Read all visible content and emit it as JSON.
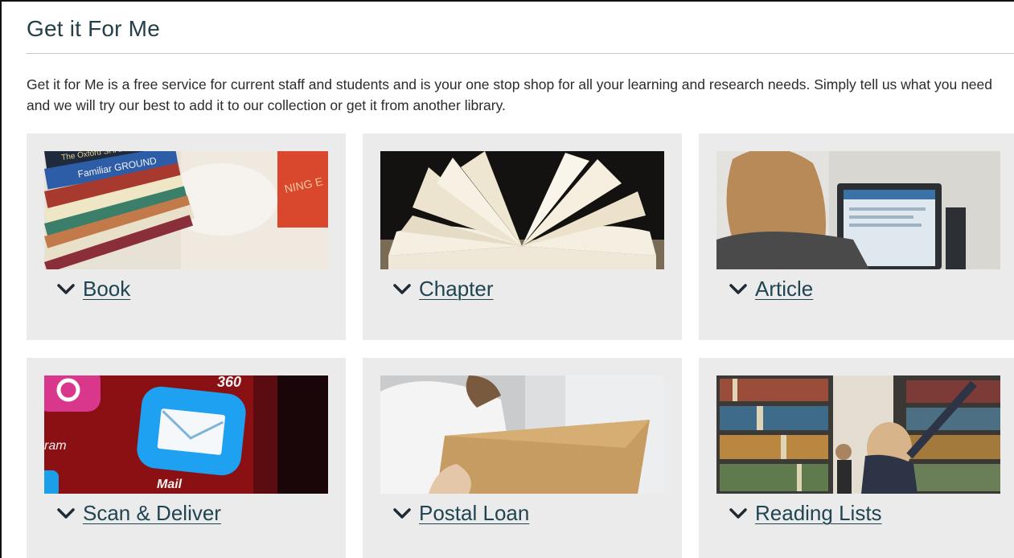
{
  "header": {
    "title": "Get it For Me",
    "intro": "Get it for Me is a free service for current staff and students and is your one stop shop for all your learning and research needs. Simply tell us what you need and we will try our best to add it to our collection or get it from another library."
  },
  "cards": [
    {
      "label": "Book",
      "icon": "chevron-down-icon",
      "image": "stack-of-books-photo"
    },
    {
      "label": "Chapter",
      "icon": "chevron-down-icon",
      "image": "open-book-pages-photo"
    },
    {
      "label": "Article",
      "icon": "chevron-down-icon",
      "image": "person-at-computer-photo"
    },
    {
      "label": "Scan & Deliver",
      "icon": "chevron-down-icon",
      "image": "mail-app-icon-photo"
    },
    {
      "label": "Postal Loan",
      "icon": "chevron-down-icon",
      "image": "envelope-in-hands-photo"
    },
    {
      "label": "Reading Lists",
      "icon": "chevron-down-icon",
      "image": "library-shelves-photo"
    }
  ],
  "images": {
    "book_spines": [
      "The Oxford SHAKESPEARE",
      "Familiar GROUND"
    ],
    "book_corner_text": "NING E",
    "app_text_1": "360",
    "app_text_2": "ram",
    "mail_label": "Mail"
  },
  "colors": {
    "title": "#243f47",
    "link": "#1f4552",
    "card_bg": "#ebebeb",
    "rule": "#c8c8c8"
  }
}
